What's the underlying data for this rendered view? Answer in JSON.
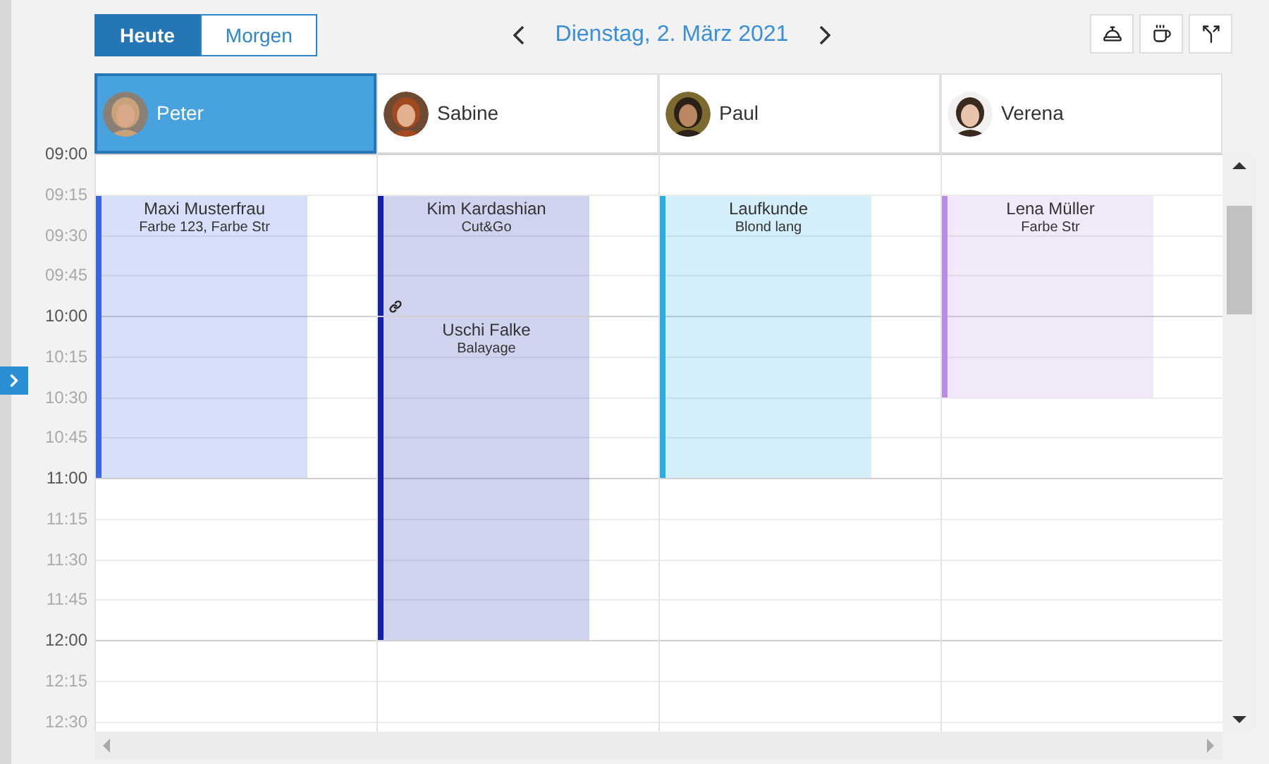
{
  "toolbar": {
    "day_tabs": [
      {
        "label": "Heute",
        "selected": true
      },
      {
        "label": "Morgen",
        "selected": false
      }
    ],
    "date": "Dienstag, 2. März 2021"
  },
  "staff": [
    {
      "name": "Peter",
      "selected": true
    },
    {
      "name": "Sabine",
      "selected": false
    },
    {
      "name": "Paul",
      "selected": false
    },
    {
      "name": "Verena",
      "selected": false
    }
  ],
  "times": [
    {
      "label": "09:00",
      "kind": "hour"
    },
    {
      "label": "09:15",
      "kind": "quarter"
    },
    {
      "label": "09:30",
      "kind": "quarter"
    },
    {
      "label": "09:45",
      "kind": "quarter"
    },
    {
      "label": "10:00",
      "kind": "hour"
    },
    {
      "label": "10:15",
      "kind": "quarter"
    },
    {
      "label": "10:30",
      "kind": "quarter"
    },
    {
      "label": "10:45",
      "kind": "quarter"
    },
    {
      "label": "11:00",
      "kind": "hour"
    },
    {
      "label": "11:15",
      "kind": "quarter"
    },
    {
      "label": "11:30",
      "kind": "quarter"
    },
    {
      "label": "11:45",
      "kind": "quarter"
    },
    {
      "label": "12:00",
      "kind": "hour"
    },
    {
      "label": "12:15",
      "kind": "quarter"
    },
    {
      "label": "12:30",
      "kind": "quarter"
    }
  ],
  "appointments": [
    [
      {
        "kind": "free"
      },
      {
        "kind": "appointment",
        "client": "Maxi Musterfrau",
        "service": "Farbe 123, Farbe Str",
        "color": "#3b66e0",
        "linked": false
      },
      {
        "kind": "continued"
      },
      {
        "kind": "continued"
      },
      {
        "kind": "continued"
      },
      {
        "kind": "continued"
      },
      {
        "kind": "continued"
      },
      {
        "kind": "continued"
      }
    ],
    [
      {
        "kind": "free"
      },
      {
        "kind": "appointment",
        "client": "Kim Kardashian",
        "service": "Cut&Go",
        "color": "#1621a8",
        "linked": true
      },
      {
        "kind": "continued"
      },
      {
        "kind": "continued"
      },
      {
        "kind": "appointment",
        "client": "Uschi Falke",
        "service": "Balayage",
        "color": "#1621a8",
        "linked": false
      },
      {
        "kind": "continued"
      },
      {
        "kind": "continued"
      },
      {
        "kind": "continued"
      },
      {
        "kind": "continued"
      },
      {
        "kind": "continued"
      },
      {
        "kind": "continued"
      },
      {
        "kind": "continued"
      }
    ],
    [
      {
        "kind": "free"
      },
      {
        "kind": "appointment",
        "client": "Laufkunde",
        "service": "Blond lang",
        "color": "#2aaee0",
        "linked": false
      },
      {
        "kind": "continued"
      },
      {
        "kind": "continued"
      },
      {
        "kind": "continued"
      },
      {
        "kind": "continued"
      },
      {
        "kind": "continued"
      },
      {
        "kind": "continued"
      }
    ],
    [
      {
        "kind": "free"
      },
      {
        "kind": "appointment",
        "client": "Lena Müller",
        "service": "Farbe Str",
        "color": "#b98de0",
        "linked": false
      },
      {
        "kind": "continued"
      },
      {
        "kind": "continued"
      },
      {
        "kind": "continued"
      },
      {
        "kind": "continued"
      }
    ]
  ]
}
